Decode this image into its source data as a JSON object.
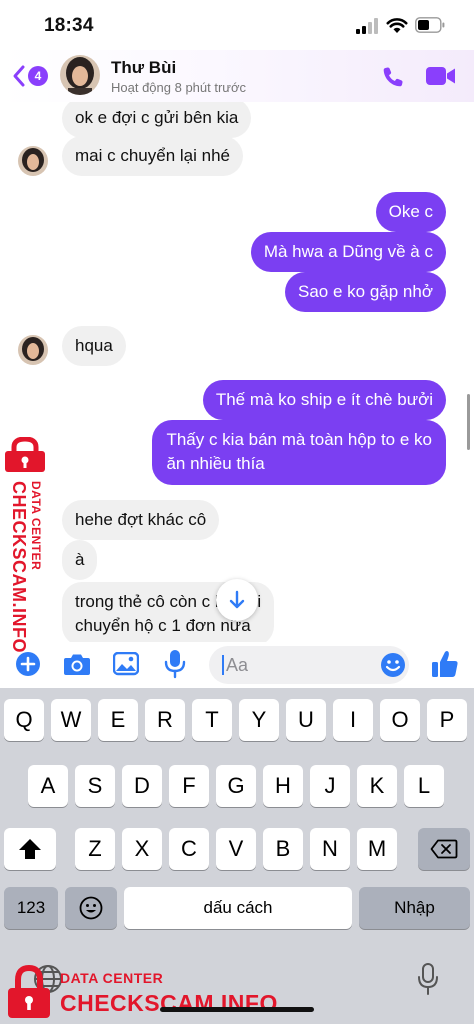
{
  "status_bar": {
    "time": "18:34"
  },
  "header": {
    "back_count": "4",
    "contact_name": "Thư Bùi",
    "activity": "Hoạt động 8 phút trước"
  },
  "messages": [
    {
      "from": "them",
      "text": "ok e đợi c gửi bên kia"
    },
    {
      "from": "them",
      "text": "mai c chuyển lại nhé"
    },
    {
      "from": "me",
      "text": "Oke c"
    },
    {
      "from": "me",
      "text": "Mà hwa a Dũng về à c"
    },
    {
      "from": "me",
      "text": "Sao e ko gặp nhở"
    },
    {
      "from": "them",
      "text": "hqua"
    },
    {
      "from": "me",
      "text": "Thế mà ko ship e ít chè bưởi"
    },
    {
      "from": "me",
      "text_line1": "Thấy c kia bán mà toàn hộp to e ko",
      "text_line2": "ăn nhiều thía"
    },
    {
      "from": "them",
      "text": "hehe đợt khác cô"
    },
    {
      "from": "them",
      "text": "à"
    },
    {
      "from": "them",
      "text_line1": "trong thẻ cô còn      c hỏi rồi",
      "text_line2": "chuyển hộ c 1 đơn nữa"
    }
  ],
  "composer": {
    "placeholder": "Aa"
  },
  "keyboard": {
    "row1": [
      "Q",
      "W",
      "E",
      "R",
      "T",
      "Y",
      "U",
      "I",
      "O",
      "P"
    ],
    "row2": [
      "A",
      "S",
      "D",
      "F",
      "G",
      "H",
      "J",
      "K",
      "L"
    ],
    "row3": [
      "Z",
      "X",
      "C",
      "V",
      "B",
      "N",
      "M"
    ],
    "numbers_key": "123",
    "space_key": "dấu cách",
    "return_key": "Nhập"
  },
  "watermark": {
    "line_small": "DATA CENTER",
    "line_big": "CHECKSCAM.INFO"
  },
  "colors": {
    "accent": "#8a3ffc",
    "outgoing_bubble": "#7b3ff2",
    "incoming_bubble": "#f0f0f0",
    "watermark": "#e2162b"
  }
}
